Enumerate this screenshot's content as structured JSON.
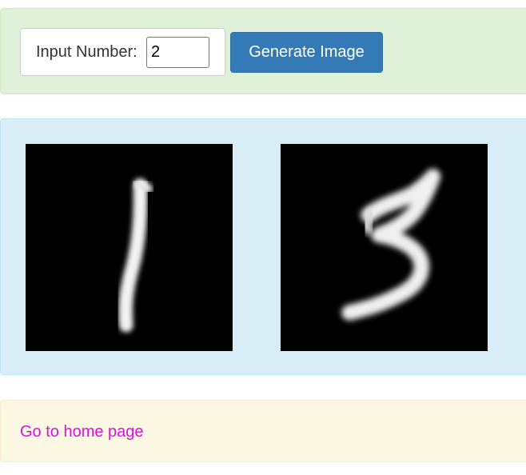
{
  "form": {
    "label": "Input Number:",
    "input_value": "2",
    "button_label": "Generate Image"
  },
  "images": {
    "items": [
      {
        "digit": "1",
        "alt": "generated-digit-1"
      },
      {
        "digit": "3",
        "alt": "generated-digit-3"
      }
    ]
  },
  "footer": {
    "home_link": "Go to home page"
  },
  "colors": {
    "form_panel": "#dff0d8",
    "image_panel": "#d9edf7",
    "link_panel": "#fcf8e3",
    "button": "#337ab7",
    "link": "#dd11dd"
  }
}
